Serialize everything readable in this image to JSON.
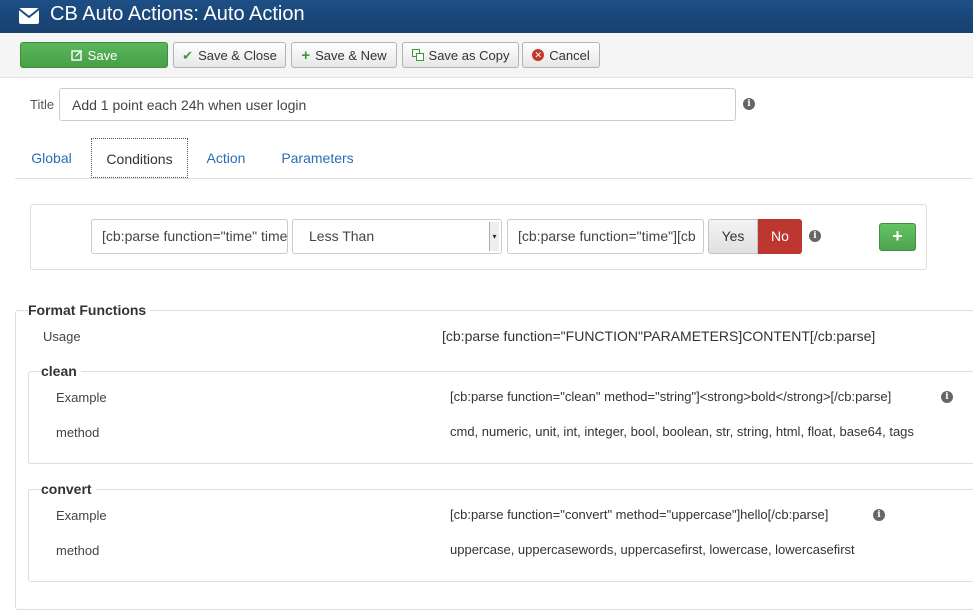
{
  "header": {
    "title": "CB Auto Actions: Auto Action"
  },
  "toolbar": {
    "save": "Save",
    "save_close": "Save & Close",
    "save_new": "Save & New",
    "save_copy": "Save as Copy",
    "cancel": "Cancel"
  },
  "form": {
    "title_label": "Title",
    "title_value": "Add 1 point each 24h when user login"
  },
  "tabs": [
    {
      "label": "Global"
    },
    {
      "label": "Conditions",
      "active": true
    },
    {
      "label": "Action"
    },
    {
      "label": "Parameters"
    }
  ],
  "condition": {
    "field1": "[cb:parse function=\"time\" time",
    "operator": "Less Than",
    "field2": "[cb:parse function=\"time\"][cb",
    "yes_label": "Yes",
    "no_label": "No",
    "selected": "No"
  },
  "format_functions": {
    "heading": "Format Functions",
    "usage_label": "Usage",
    "usage_value": "[cb:parse function=\"FUNCTION\"PARAMETERS]CONTENT[/cb:parse]",
    "clean": {
      "heading": "clean",
      "example_label": "Example",
      "example_value": "[cb:parse function=\"clean\" method=\"string\"]<strong>bold</strong>[/cb:parse]",
      "method_label": "method",
      "method_value": "cmd, numeric, unit, int, integer, bool, boolean, str, string, html, float, base64, tags"
    },
    "convert": {
      "heading": "convert",
      "example_label": "Example",
      "example_value": "[cb:parse function=\"convert\" method=\"uppercase\"]hello[/cb:parse]",
      "method_label": "method",
      "method_value": "uppercase, uppercasewords, uppercasefirst, lowercase, lowercasefirst"
    }
  },
  "colors": {
    "header_bg": "#1d4f86",
    "save_green": "#5bb75b",
    "no_red": "#bd362f",
    "link_blue": "#2a6fb5"
  }
}
